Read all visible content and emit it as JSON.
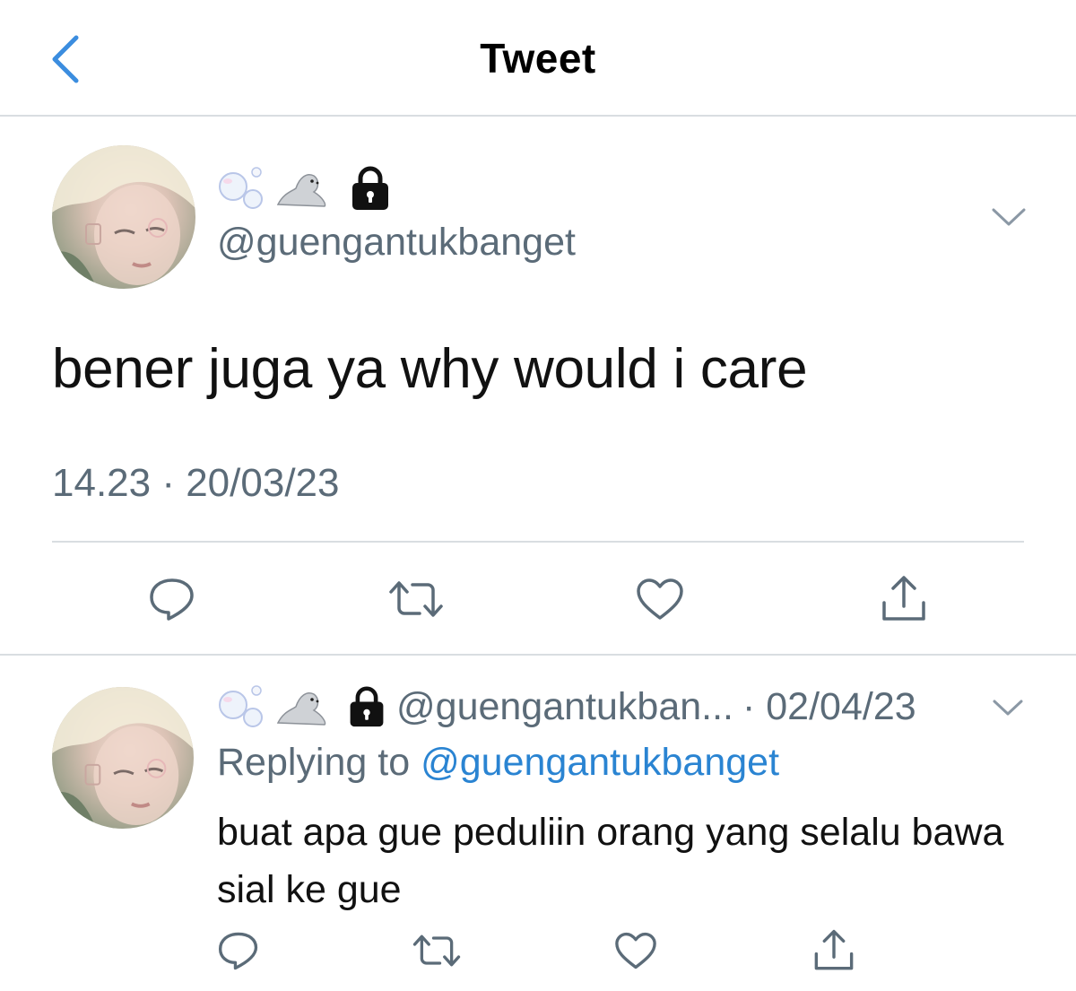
{
  "header": {
    "title": "Tweet",
    "back_icon": "chevron-left-icon",
    "accent": "#3b8ddf"
  },
  "main_tweet": {
    "display_name_emojis": [
      "bubbles-emoji",
      "seal-emoji",
      "lock-icon"
    ],
    "handle": "@guengantukbanget",
    "text": "bener juga ya why would i care",
    "timestamp": "14.23 · 20/03/23",
    "actions": [
      "reply-icon",
      "retweet-icon",
      "like-icon",
      "share-icon"
    ]
  },
  "reply": {
    "display_name_emojis": [
      "bubbles-emoji",
      "seal-emoji",
      "lock-icon"
    ],
    "handle": "@guengantukban...",
    "date": "· 02/04/23",
    "replying_prefix": "Replying to",
    "replying_handle": "@guengantukbanget",
    "text": "buat apa gue peduliin orang yang selalu bawa sial ke gue",
    "actions": [
      "reply-icon",
      "retweet-icon",
      "like-icon",
      "share-icon"
    ]
  },
  "colors": {
    "secondary_text": "#5b6b78",
    "link": "#2a84d2",
    "divider": "#d9dde1",
    "icon": "#5b6b78"
  }
}
